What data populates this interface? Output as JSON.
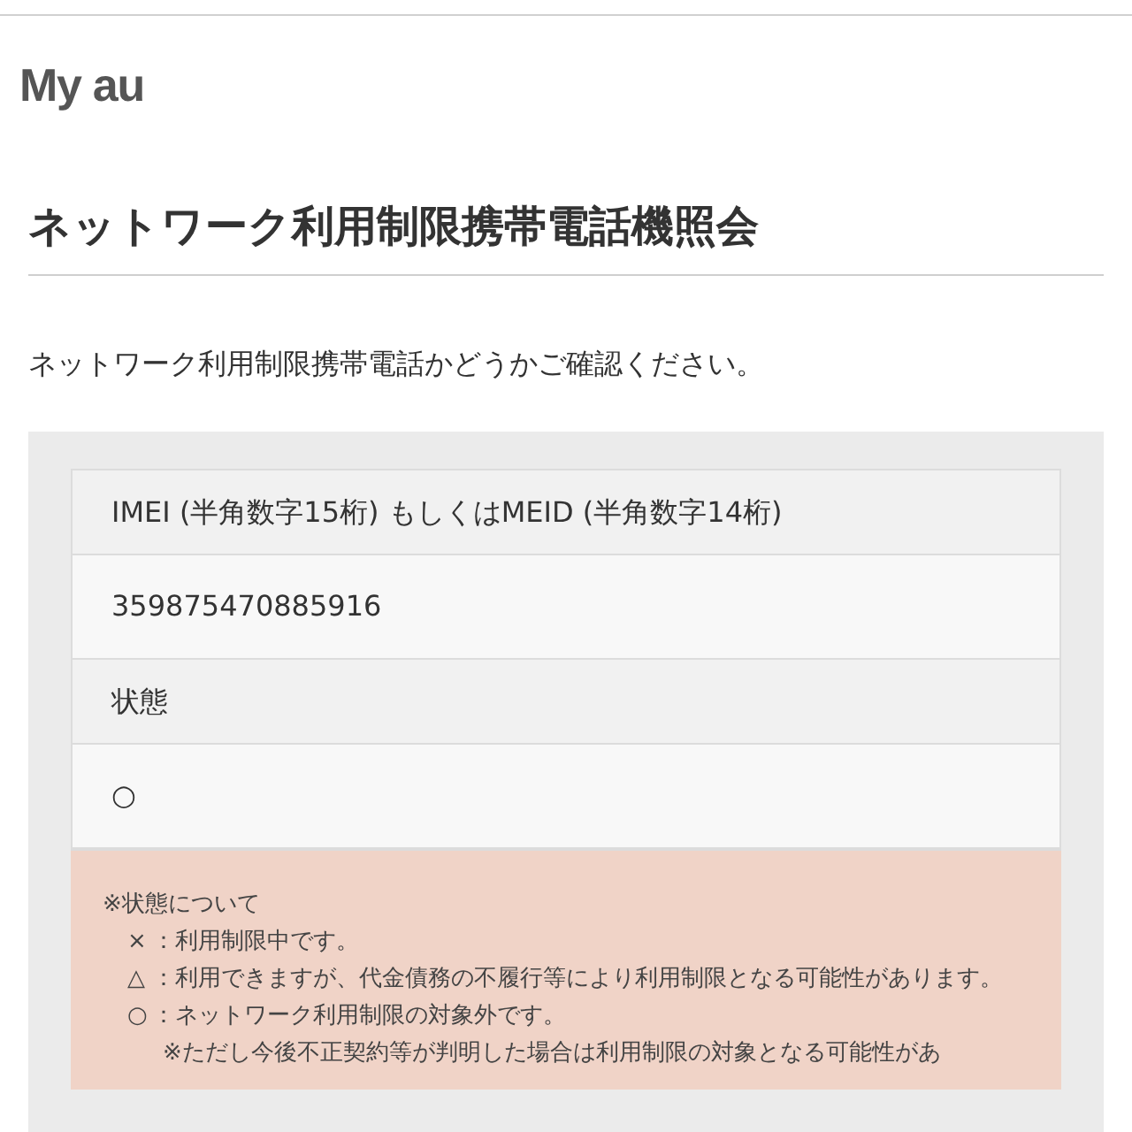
{
  "header": {
    "logo": "My au"
  },
  "title": "ネットワーク利用制限携帯電話機照会",
  "intro": "ネットワーク利用制限携帯電話かどうかご確認ください。",
  "result_table": [
    {
      "label": "IMEI (半角数字15桁) もしくはMEID (半角数字14桁)",
      "value": "359875470885916"
    },
    {
      "label": "状態",
      "value": "○"
    }
  ],
  "note": {
    "heading": "※状態について",
    "items": [
      {
        "mark": "×",
        "text": "：利用制限中です。"
      },
      {
        "mark": "△",
        "text": "：利用できますが、代金債務の不履行等により利用制限となる可能性があります。"
      },
      {
        "mark": "○",
        "text": "：ネットワーク利用制限の対象外です。",
        "subnote": "※ただし今後不正契約等が判明した場合は利用制限の対象となる可能性があ"
      }
    ]
  }
}
